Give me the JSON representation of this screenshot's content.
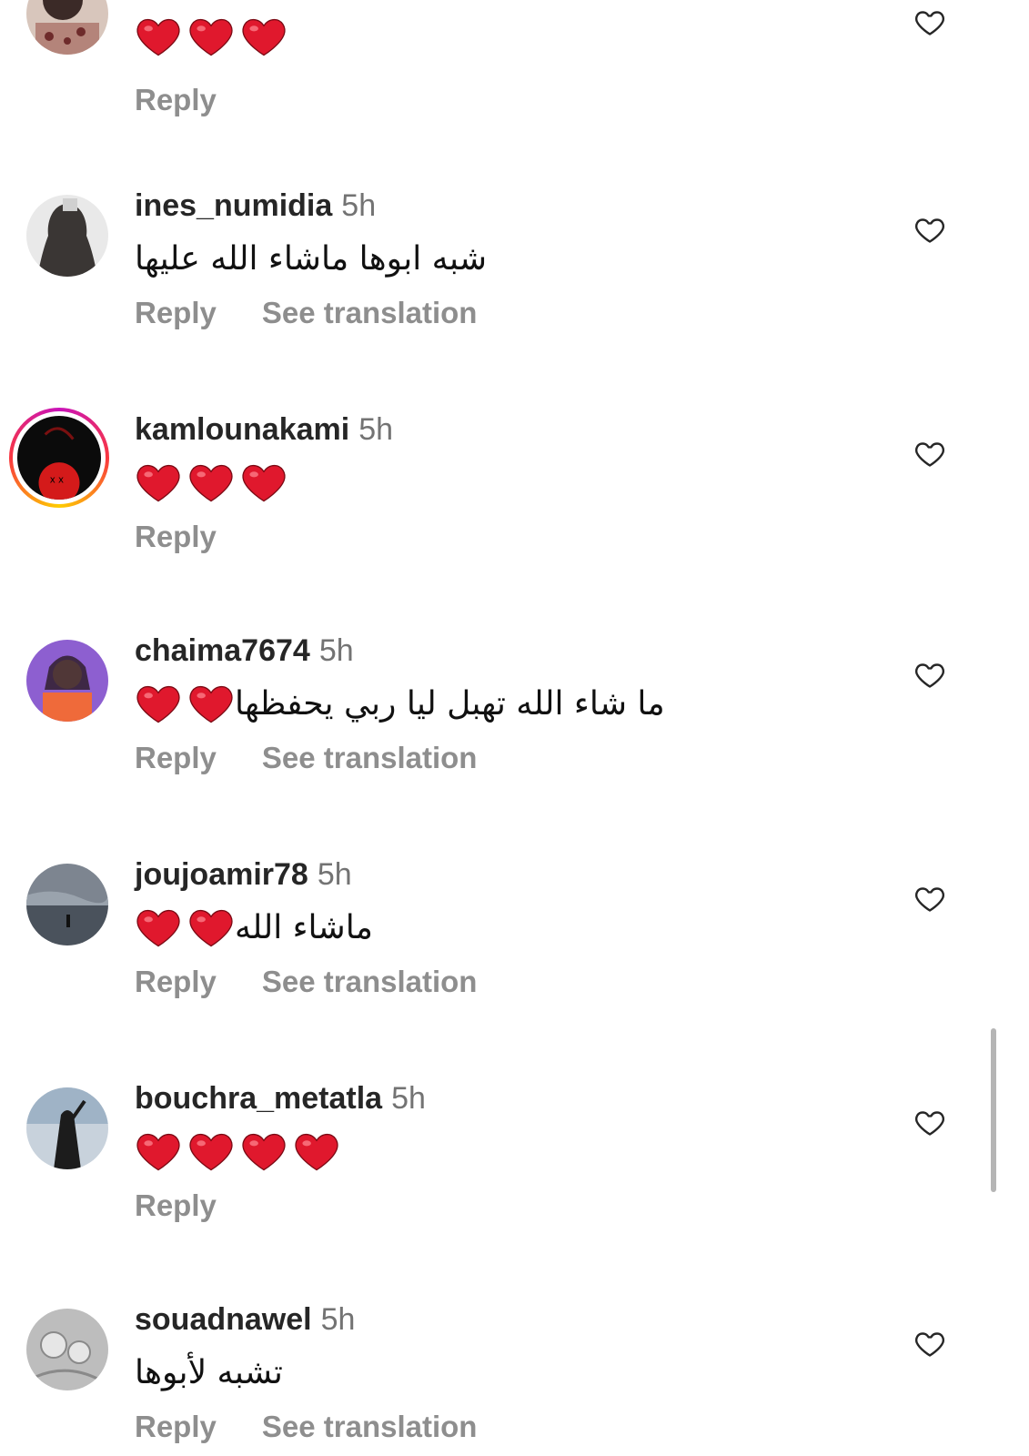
{
  "comments": [
    {
      "username": "",
      "time": "",
      "text": "",
      "heart_count": 3,
      "reply_label": "Reply",
      "translate_label": ""
    },
    {
      "username": "ines_numidia",
      "time": "5h",
      "text": "شبه ابوها ماشاء الله عليها",
      "heart_count": 0,
      "reply_label": "Reply",
      "translate_label": "See translation"
    },
    {
      "username": "kamlounakami",
      "time": "5h",
      "text": "",
      "heart_count": 3,
      "reply_label": "Reply",
      "translate_label": ""
    },
    {
      "username": "chaima7674",
      "time": "5h",
      "text": "ما شاء الله تهبل ليا ربي يحفظها",
      "heart_count": 2,
      "reply_label": "Reply",
      "translate_label": "See translation"
    },
    {
      "username": "joujoamir78",
      "time": "5h",
      "text": "ماشاء الله",
      "heart_count": 2,
      "reply_label": "Reply",
      "translate_label": "See translation"
    },
    {
      "username": "bouchra_metatla",
      "time": "5h",
      "text": "",
      "heart_count": 4,
      "reply_label": "Reply",
      "translate_label": ""
    },
    {
      "username": "souadnawel",
      "time": "5h",
      "text": "تشبه لأبوها",
      "heart_count": 0,
      "reply_label": "Reply",
      "translate_label": "See translation"
    }
  ],
  "colors": {
    "heart_emoji": "#e0182d",
    "username": "#262626",
    "meta": "#8e8e8e",
    "story_ring": "#c913b9"
  },
  "icons": {
    "like": "heart-outline-icon",
    "reaction": "red-heart-emoji"
  }
}
